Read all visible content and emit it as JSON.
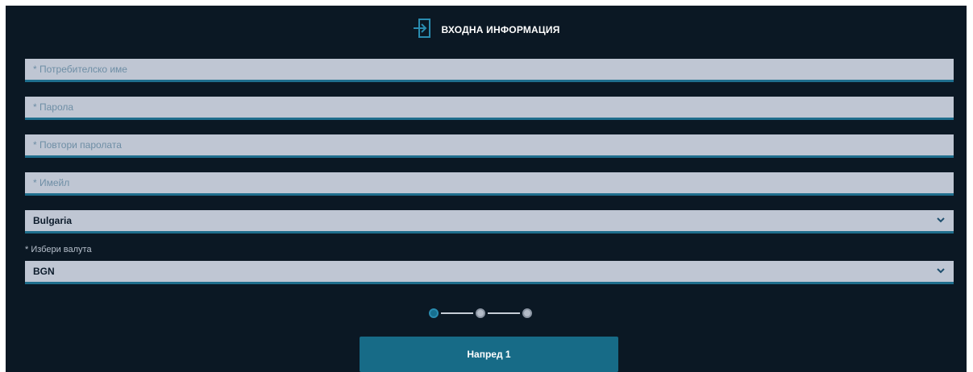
{
  "header": {
    "title": "ВХОДНА ИНФОРМАЦИЯ",
    "icon": "login-door-icon"
  },
  "form": {
    "username": {
      "placeholder": "* Потребителско име",
      "value": ""
    },
    "password": {
      "placeholder": "* Парола",
      "value": ""
    },
    "repeat_password": {
      "placeholder": "* Повтори паролата",
      "value": ""
    },
    "email": {
      "placeholder": "* Имейл",
      "value": ""
    },
    "country": {
      "selected": "Bulgaria"
    },
    "currency": {
      "label": "* Избери валута",
      "selected": "BGN"
    }
  },
  "stepper": {
    "current_step": 1,
    "total_steps": 3
  },
  "next_button": {
    "label": "Напред 1"
  },
  "colors": {
    "background": "#0b1824",
    "field": "#bfc6d3",
    "accent": "#176b87",
    "placeholder": "#6e8ea5"
  }
}
